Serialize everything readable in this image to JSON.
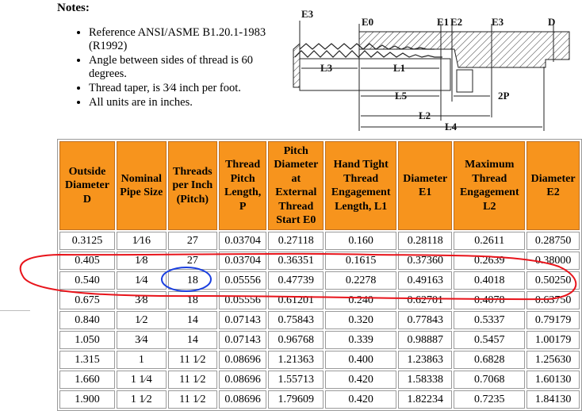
{
  "notes": {
    "heading": "Notes:",
    "items": [
      "Reference ANSI/ASME B1.20.1-1983 (R1992)",
      "Angle between sides of thread is 60 degrees.",
      "Thread taper, is 3⁄4 inch per foot.",
      "All units are in inches."
    ]
  },
  "diagram_labels": {
    "e3_left": "E3",
    "e0": "E0",
    "e1": "E1",
    "e2": "E2",
    "e3_right": "E3",
    "d": "D",
    "l3": "L3",
    "l1": "L1",
    "l5": "L5",
    "l2": "L2",
    "l4": "L4",
    "two_p": "2P"
  },
  "table": {
    "headers": [
      "Outside Diameter D",
      "Nominal Pipe Size",
      "Threads per Inch (Pitch)",
      "Thread Pitch Length, P",
      "Pitch Diameter at External Thread Start E0",
      "Hand Tight Thread Engagement Length, L1",
      "Diameter E1",
      "Maximum Thread Engagement L2",
      "Diameter E2"
    ],
    "rows": [
      [
        "0.3125",
        "1⁄16",
        "27",
        "0.03704",
        "0.27118",
        "0.160",
        "0.28118",
        "0.2611",
        "0.28750"
      ],
      [
        "0.405",
        "1⁄8",
        "27",
        "0.03704",
        "0.36351",
        "0.1615",
        "0.37360",
        "0.2639",
        "0.38000"
      ],
      [
        "0.540",
        "1⁄4",
        "18",
        "0.05556",
        "0.47739",
        "0.2278",
        "0.49163",
        "0.4018",
        "0.50250"
      ],
      [
        "0.675",
        "3⁄8",
        "18",
        "0.05556",
        "0.61201",
        "0.240",
        "0.62701",
        "0.4078",
        "0.63750"
      ],
      [
        "0.840",
        "1⁄2",
        "14",
        "0.07143",
        "0.75843",
        "0.320",
        "0.77843",
        "0.5337",
        "0.79179"
      ],
      [
        "1.050",
        "3⁄4",
        "14",
        "0.07143",
        "0.96768",
        "0.339",
        "0.98887",
        "0.5457",
        "1.00179"
      ],
      [
        "1.315",
        "1",
        "11 1⁄2",
        "0.08696",
        "1.21363",
        "0.400",
        "1.23863",
        "0.6828",
        "1.25630"
      ],
      [
        "1.660",
        "1 1⁄4",
        "11 1⁄2",
        "0.08696",
        "1.55713",
        "0.420",
        "1.58338",
        "0.7068",
        "1.60130"
      ],
      [
        "1.900",
        "1 1⁄2",
        "11 1⁄2",
        "0.08696",
        "1.79609",
        "0.420",
        "1.82234",
        "0.7235",
        "1.84130"
      ]
    ]
  },
  "annotation_color": "#e8141b",
  "circle_color": "#1a3fe0",
  "header_color": "#f7941d"
}
